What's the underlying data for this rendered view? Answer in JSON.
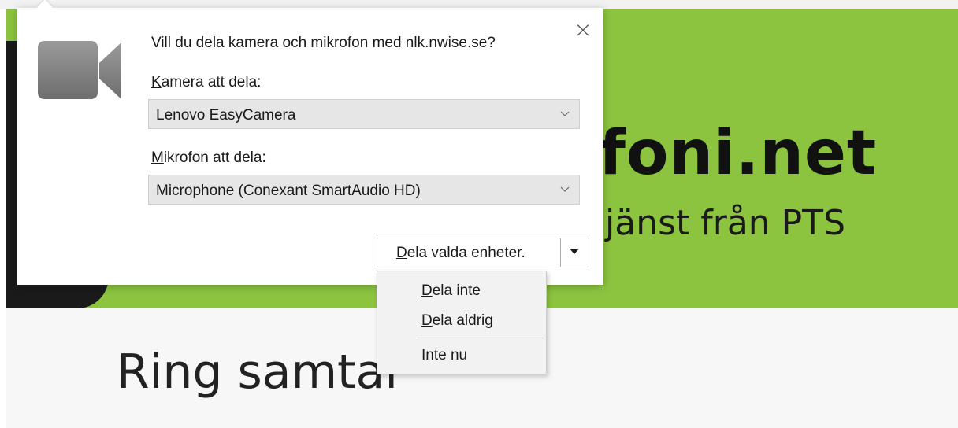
{
  "site": {
    "brand_title": "foni.net",
    "brand_subtitle": "jänst från PTS",
    "page_heading": "Ring samtal"
  },
  "popup": {
    "question": "Vill du dela kamera och mikrofon med nlk.nwise.se?",
    "close_symbol": "×",
    "camera": {
      "label_accesskey": "K",
      "label_rest": "amera att dela:",
      "selected": "Lenovo EasyCamera"
    },
    "microphone": {
      "label_accesskey": "M",
      "label_rest": "ikrofon att dela:",
      "selected": "Microphone (Conexant SmartAudio HD)"
    },
    "share_button": {
      "label_accesskey": "D",
      "label_rest": "ela valda enheter."
    },
    "menu": [
      {
        "accesskey": "D",
        "rest": "ela inte"
      },
      {
        "accesskey": "D",
        "rest": "ela aldrig"
      },
      {
        "accesskey": "",
        "rest": "Inte nu"
      }
    ]
  },
  "colors": {
    "banner_green": "#8cc43f",
    "popup_bg": "#ffffff",
    "select_bg": "#e6e6e6",
    "menu_bg": "#f2f2f2"
  },
  "icons": {
    "camera": "video-camera-icon",
    "close": "close-icon",
    "select_arrow": "chevron-down-icon",
    "split_arrow": "triangle-down-icon"
  }
}
